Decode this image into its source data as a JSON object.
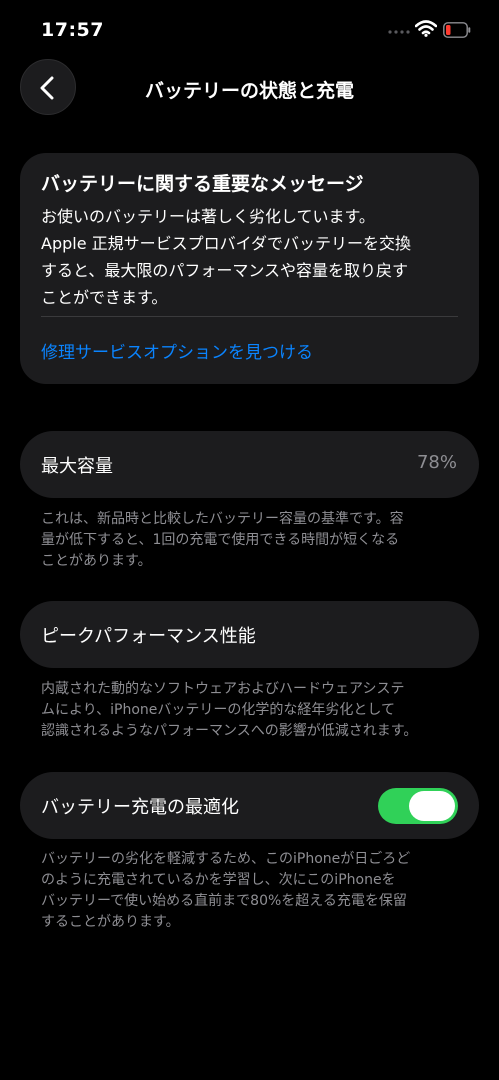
{
  "status_bar": {
    "time": "17:57",
    "icons": [
      "signal-dots-icon",
      "wifi-icon",
      "battery-low-icon"
    ]
  },
  "nav": {
    "back_icon": "chevron-left-icon",
    "title": "バッテリーの状態と充電"
  },
  "message_card": {
    "title": "バッテリーに関する重要なメッセージ",
    "body_lines": [
      "お使いのバッテリーは著しく劣化しています。",
      "Apple 正規サービスプロバイダでバッテリーを交換",
      "すると、最大限のパフォーマンスや容量を取り戻す",
      "ことができます。"
    ],
    "link": "修理サービスオプションを見つける"
  },
  "max_capacity": {
    "label": "最大容量",
    "value": "78%",
    "footnote_lines": [
      "これは、新品時と比較したバッテリー容量の基準です。容",
      "量が低下すると、1回の充電で使用できる時間が短くなる",
      "ことがあります。"
    ]
  },
  "peak_performance": {
    "label": "ピークパフォーマンス性能",
    "footnote_lines": [
      "内蔵された動的なソフトウェアおよびハードウェアシステ",
      "ムにより、iPhoneバッテリーの化学的な経年劣化として",
      "認識されるようなパフォーマンスへの影響が低減されます。"
    ]
  },
  "optimized_charging": {
    "label": "バッテリー充電の最適化",
    "enabled": true,
    "footnote_lines": [
      "バッテリーの劣化を軽減するため、このiPhoneが日ごろど",
      "のように充電されているかを学習し、次にこのiPhoneを",
      "バッテリーで使い始める直前まで80%を超える充電を保留",
      "することがあります。"
    ]
  },
  "colors": {
    "background": "#000000",
    "card": "#1c1c1e",
    "link": "#0a84ff",
    "toggle_on": "#30d158",
    "secondary_text": "#8e8e93",
    "battery_low": "#ff3b30"
  }
}
